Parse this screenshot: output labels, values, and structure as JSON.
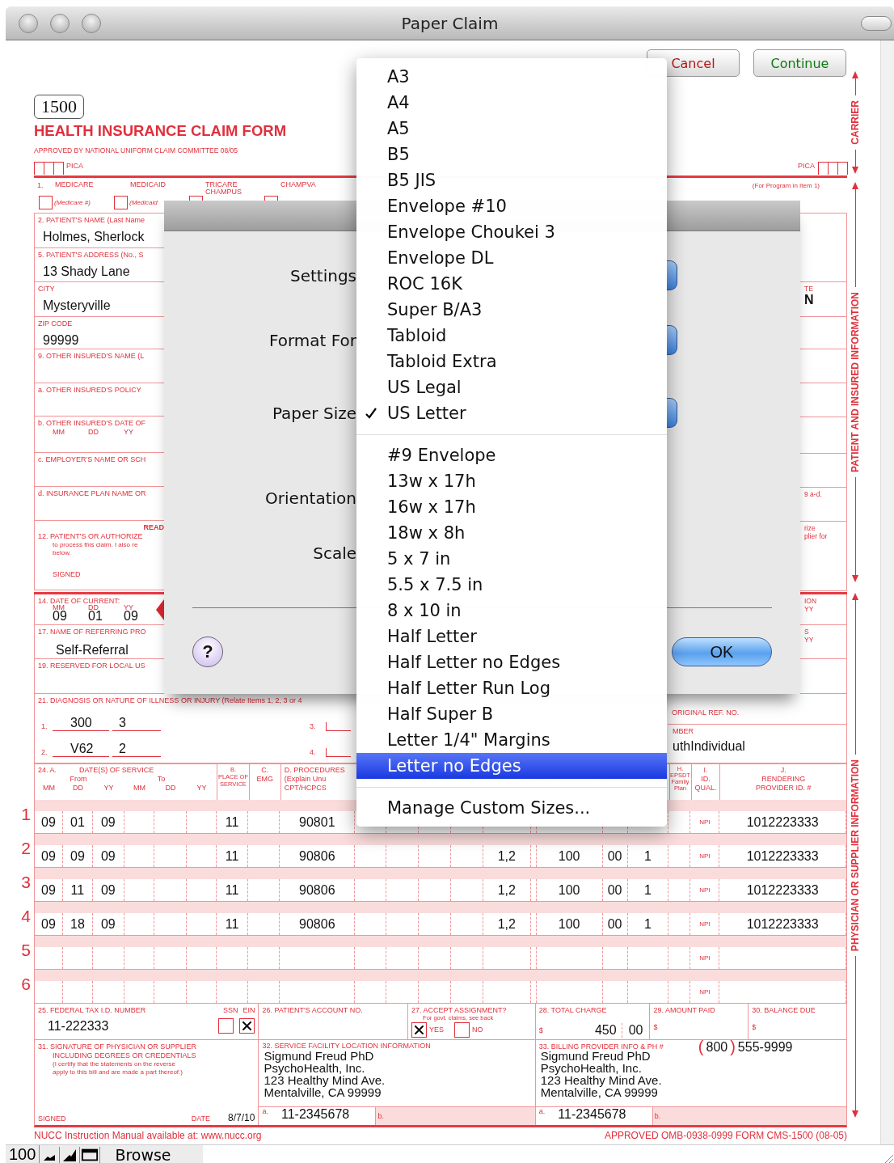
{
  "window": {
    "title": "Paper Claim"
  },
  "actions": [
    {
      "label": "Cancel",
      "kind": "cancel"
    },
    {
      "label": "Continue",
      "kind": "continue"
    }
  ],
  "form": {
    "number": "1500",
    "title": "HEALTH INSURANCE CLAIM FORM",
    "approval": "APPROVED BY NATIONAL UNIFORM CLAIM COMMITTEE 08/05",
    "pica": [
      "PICA",
      "PICA"
    ],
    "program_note": "(For Program in Item 1)",
    "item_1_number": "1.",
    "programs": [
      {
        "label": "MEDICARE",
        "id_hint": "(Medicare #)",
        "checked": false
      },
      {
        "label": "MEDICAID",
        "id_hint": "(Medicaid",
        "checked": false
      },
      {
        "label": "TRICARE CHAMPUS",
        "checked": false
      },
      {
        "label": "CHAMPVA",
        "checked": false
      }
    ],
    "left_fields": [
      {
        "kind": "text",
        "label": "2. PATIENT'S NAME (Last Name",
        "value": "Holmes, Sherlock"
      },
      {
        "kind": "text",
        "label": "5. PATIENT'S ADDRESS (No., S",
        "value": "13 Shady Lane"
      },
      {
        "kind": "text",
        "label": "CITY",
        "value": "Mysteryville"
      },
      {
        "kind": "text",
        "label": "ZIP CODE",
        "value": "99999"
      },
      {
        "kind": "text",
        "label": "9. OTHER INSURED'S NAME (L"
      },
      {
        "kind": "text",
        "label": "a. OTHER INSURED'S POLICY"
      },
      {
        "kind": "date",
        "label": "b. OTHER INSURED'S DATE OF",
        "parts": [
          "MM",
          "DD",
          "YY"
        ]
      },
      {
        "kind": "text",
        "label": "c. EMPLOYER'S NAME OR SCH"
      },
      {
        "kind": "text",
        "label": "d. INSURANCE PLAN NAME OR"
      },
      {
        "kind": "authorization",
        "heading": "READ",
        "label": "12. PATIENT'S OR AUTHORIZE",
        "lines": [
          "to process this claim. I also re",
          "below."
        ],
        "signed": "SIGNED"
      }
    ],
    "right_fragments": [
      {
        "lines": [
          {
            "text": "TE",
            "kind": "label"
          },
          {
            "text": "N",
            "kind": "value"
          }
        ]
      },
      {
        "lines": [
          {
            "text": "9 a-d.",
            "kind": "label"
          }
        ]
      },
      {
        "lines": [
          {
            "text": "rize",
            "kind": "label"
          },
          {
            "text": "plier for",
            "kind": "label"
          }
        ]
      }
    ],
    "current_date": {
      "label": "14. DATE OF CURRENT:",
      "parts": [
        "MM",
        "DD",
        "YY"
      ],
      "values": [
        "09",
        "01",
        "09"
      ],
      "right_fragment": [
        "ION",
        "YY"
      ]
    },
    "referring": {
      "label": "17. NAME OF REFERRING PRO",
      "value": "Self-Referral",
      "right_fragment": [
        "S",
        "YY"
      ]
    },
    "reserved": {
      "label": "19. RESERVED FOR LOCAL US"
    },
    "diagnosis": {
      "label": "21. DIAGNOSIS OR NATURE OF ILLNESS OR INJURY (Relate Items 1, 2, 3 or 4",
      "codes": [
        {
          "number": "1.",
          "main": "300",
          "sub": "3"
        },
        {
          "number": "2.",
          "main": "V62",
          "sub": "2"
        }
      ],
      "more": [
        "3.",
        "4."
      ]
    },
    "resubmission": {
      "label": "ORIGINAL REF. NO."
    },
    "authorization_number": {
      "label": "MBER",
      "value": "uthIndividual"
    },
    "service_header": {
      "item": "24. A.",
      "dates": "DATE(S) OF SERVICE",
      "from": "From",
      "to": "To",
      "date_parts": [
        "MM",
        "DD",
        "YY",
        "MM",
        "DD",
        "YY"
      ],
      "place": [
        "B.",
        "PLACE OF",
        "SERVICE"
      ],
      "emg": [
        "C.",
        "EMG"
      ],
      "procedures": [
        "D. PROCEDURES",
        "(Explain Unu",
        "CPT/HCPCS"
      ],
      "epsdt": [
        "H.",
        "EPSDT Family Plan"
      ],
      "qualifier": [
        "I.",
        "ID.",
        "QUAL."
      ],
      "provider": [
        "J.",
        "RENDERING",
        "PROVIDER ID. #"
      ]
    },
    "service_lines": [
      {
        "number": "1",
        "from": [
          "09",
          "01",
          "09"
        ],
        "place": "11",
        "cpt": "90801",
        "qualifier": "NPI",
        "provider_id": "1012223333"
      },
      {
        "number": "2",
        "from": [
          "09",
          "09",
          "09"
        ],
        "place": "11",
        "cpt": "90806",
        "pointer": "1,2",
        "charge": "100",
        "cents": "00",
        "units": "1",
        "qualifier": "NPI",
        "provider_id": "1012223333"
      },
      {
        "number": "3",
        "from": [
          "09",
          "11",
          "09"
        ],
        "place": "11",
        "cpt": "90806",
        "pointer": "1,2",
        "charge": "100",
        "cents": "00",
        "units": "1",
        "qualifier": "NPI",
        "provider_id": "1012223333"
      },
      {
        "number": "4",
        "from": [
          "09",
          "18",
          "09"
        ],
        "place": "11",
        "cpt": "90806",
        "pointer": "1,2",
        "charge": "100",
        "cents": "00",
        "units": "1",
        "qualifier": "NPI",
        "provider_id": "1012223333"
      },
      {
        "number": "5",
        "qualifier": "NPI"
      },
      {
        "number": "6",
        "qualifier": "NPI"
      }
    ],
    "tax_id": {
      "label": "25. FEDERAL TAX I.D. NUMBER",
      "value": "11-222333",
      "ssn_label": "SSN",
      "ein_label": "EIN",
      "ssn_checked": false,
      "ein_checked": true
    },
    "account": {
      "label": "26. PATIENT'S ACCOUNT NO."
    },
    "assignment": {
      "label": "27. ACCEPT ASSIGNMENT?",
      "note": "For govt. claims, see back",
      "yes_label": "YES",
      "no_label": "NO",
      "yes_checked": true,
      "no_checked": false
    },
    "total_charge": {
      "label": "28. TOTAL CHARGE",
      "currency": "$",
      "value": "450",
      "cents": "00"
    },
    "amount_paid": {
      "label": "29. AMOUNT PAID",
      "currency": "$"
    },
    "balance_due": {
      "label": "30. BALANCE DUE",
      "currency": "$"
    },
    "signature": {
      "lines": [
        "31. SIGNATURE OF PHYSICIAN OR SUPPLIER",
        "INCLUDING DEGREES OR CREDENTIALS"
      ],
      "note": [
        "(I certify that the statements on the reverse",
        "apply to this bill and are made a part thereof.)"
      ],
      "signed": "SIGNED",
      "date_label": "DATE",
      "date": "8/7/10"
    },
    "facility": {
      "label": "32. SERVICE FACILITY LOCATION INFORMATION",
      "lines": [
        "Sigmund Freud PhD",
        "PsychoHealth, Inc.",
        "123 Healthy Mind Ave.",
        "Mentalville, CA 99999"
      ],
      "a_label": "a.",
      "a_value": "11-2345678",
      "b_label": "b."
    },
    "billing": {
      "label": "33. BILLING PROVIDER INFO & PH #",
      "open_paren": "(",
      "area_code": "800",
      "close_paren": ")",
      "phone": "555-9999",
      "lines": [
        "Sigmund Freud PhD",
        "PsychoHealth, Inc.",
        "123 Healthy Mind Ave.",
        "Mentalville, CA 99999"
      ],
      "a_label": "a.",
      "a_value": "11-2345678",
      "b_label": "b."
    },
    "footer_left": "NUCC Instruction Manual available at: www.nucc.org",
    "footer_right": "APPROVED OMB-0938-0999 FORM CMS-1500 (08-05)",
    "side_labels": [
      "CARRIER",
      "PATIENT AND INSURED INFORMATION",
      "PHYSICIAN OR SUPPLIER INFORMATION"
    ]
  },
  "dialog": {
    "labels": [
      "Settings",
      "Format For",
      "Paper Size",
      "Orientation",
      "Scale"
    ],
    "help": "?",
    "ok": "OK"
  },
  "menu": {
    "groups": [
      [
        {
          "label": "A3",
          "checked": false,
          "selected": false
        },
        {
          "label": "A4",
          "checked": false,
          "selected": false
        },
        {
          "label": "A5",
          "checked": false,
          "selected": false
        },
        {
          "label": "B5",
          "checked": false,
          "selected": false
        },
        {
          "label": "B5 JIS",
          "checked": false,
          "selected": false
        },
        {
          "label": "Envelope #10",
          "checked": false,
          "selected": false
        },
        {
          "label": "Envelope Choukei 3",
          "checked": false,
          "selected": false
        },
        {
          "label": "Envelope DL",
          "checked": false,
          "selected": false
        },
        {
          "label": "ROC 16K",
          "checked": false,
          "selected": false
        },
        {
          "label": "Super B/A3",
          "checked": false,
          "selected": false
        },
        {
          "label": "Tabloid",
          "checked": false,
          "selected": false
        },
        {
          "label": "Tabloid Extra",
          "checked": false,
          "selected": false
        },
        {
          "label": "US Legal",
          "checked": false,
          "selected": false
        },
        {
          "label": "US Letter",
          "checked": true,
          "selected": false
        }
      ],
      [
        {
          "label": "#9 Envelope",
          "checked": false,
          "selected": false
        },
        {
          "label": "13w x 17h",
          "checked": false,
          "selected": false
        },
        {
          "label": "16w x 17h",
          "checked": false,
          "selected": false
        },
        {
          "label": "18w x 8h",
          "checked": false,
          "selected": false
        },
        {
          "label": "5 x 7 in",
          "checked": false,
          "selected": false
        },
        {
          "label": "5.5 x 7.5 in",
          "checked": false,
          "selected": false
        },
        {
          "label": "8 x 10 in",
          "checked": false,
          "selected": false
        },
        {
          "label": "Half Letter",
          "checked": false,
          "selected": false
        },
        {
          "label": "Half Letter no Edges",
          "checked": false,
          "selected": false
        },
        {
          "label": "Half Letter Run Log",
          "checked": false,
          "selected": false
        },
        {
          "label": "Half Super B",
          "checked": false,
          "selected": false
        },
        {
          "label": "Letter 1/4\" Margins",
          "checked": false,
          "selected": false
        },
        {
          "label": "Letter no Edges",
          "checked": false,
          "selected": true
        }
      ],
      [
        {
          "label": "Manage Custom Sizes...",
          "checked": false,
          "selected": false
        }
      ]
    ]
  },
  "status_bar": {
    "zoom": "100",
    "mode": "Browse"
  }
}
